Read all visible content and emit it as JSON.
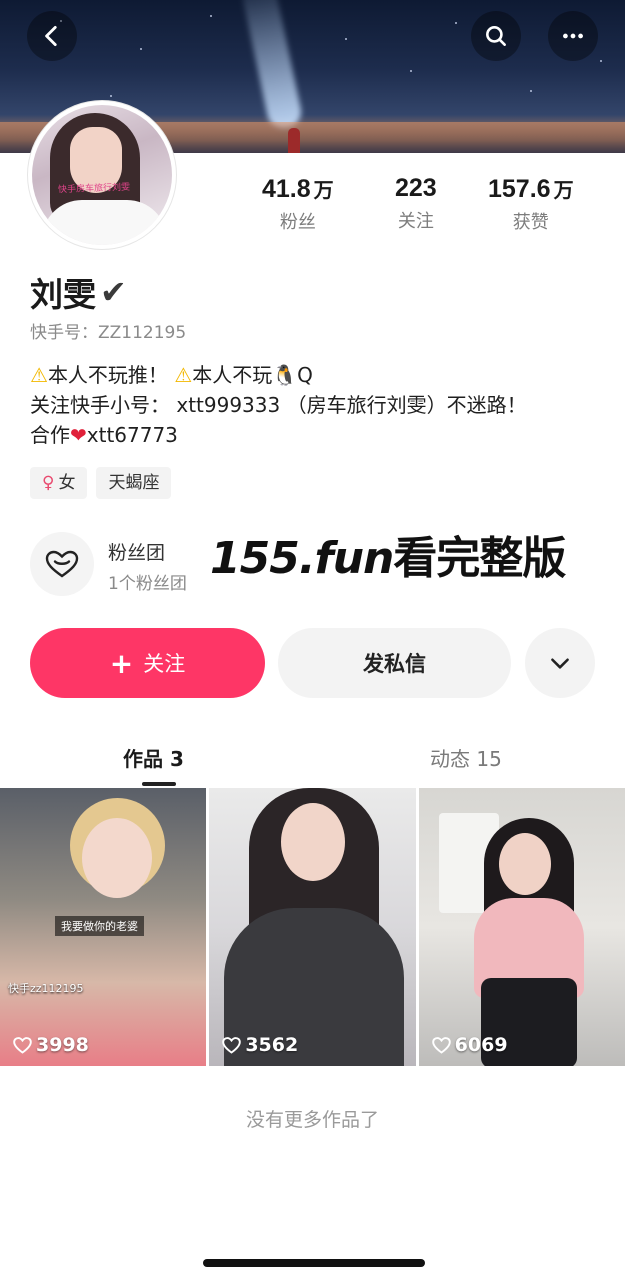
{
  "header": {
    "back_icon": "chevron-left-icon",
    "search_icon": "search-icon",
    "more_icon": "more-horizontal-icon"
  },
  "profile": {
    "name": "刘雯",
    "verified_mark": "✔",
    "kuaishou_id": "快手号：ZZ112195",
    "avatar_stamp": "快手房车旅行刘雯"
  },
  "stats": [
    {
      "value": "41.8",
      "unit": "万",
      "label": "粉丝"
    },
    {
      "value": "223",
      "unit": "",
      "label": "关注"
    },
    {
      "value": "157.6",
      "unit": "万",
      "label": "获赞"
    }
  ],
  "bio": {
    "line1_a": "本人不玩推！",
    "line1_b": "本人不玩",
    "line1_c": "Q",
    "line2": "关注快手小号： xtt999333 （房车旅行刘雯）不迷路！",
    "line3_a": "合作",
    "line3_b": "xtt67773"
  },
  "tags": {
    "gender": "女",
    "zodiac": "天蝎座"
  },
  "fan_club": {
    "title": "粉丝团",
    "count": "1个粉丝团"
  },
  "promo": {
    "domain": "155.fun",
    "text": "看完整版"
  },
  "actions": {
    "follow": "关注",
    "message": "发私信"
  },
  "tabs": [
    {
      "label": "作品 3",
      "active": true
    },
    {
      "label": "动态 15",
      "active": false
    }
  ],
  "videos": [
    {
      "likes": "3998",
      "caption": "我要做你的老婆",
      "watermark": "快手zz112195"
    },
    {
      "likes": "3562"
    },
    {
      "likes": "6069"
    }
  ],
  "footer": {
    "end_text": "没有更多作品了"
  },
  "colors": {
    "accent": "#fe3666",
    "warning": "#f2b800",
    "heart": "#e0213a"
  }
}
